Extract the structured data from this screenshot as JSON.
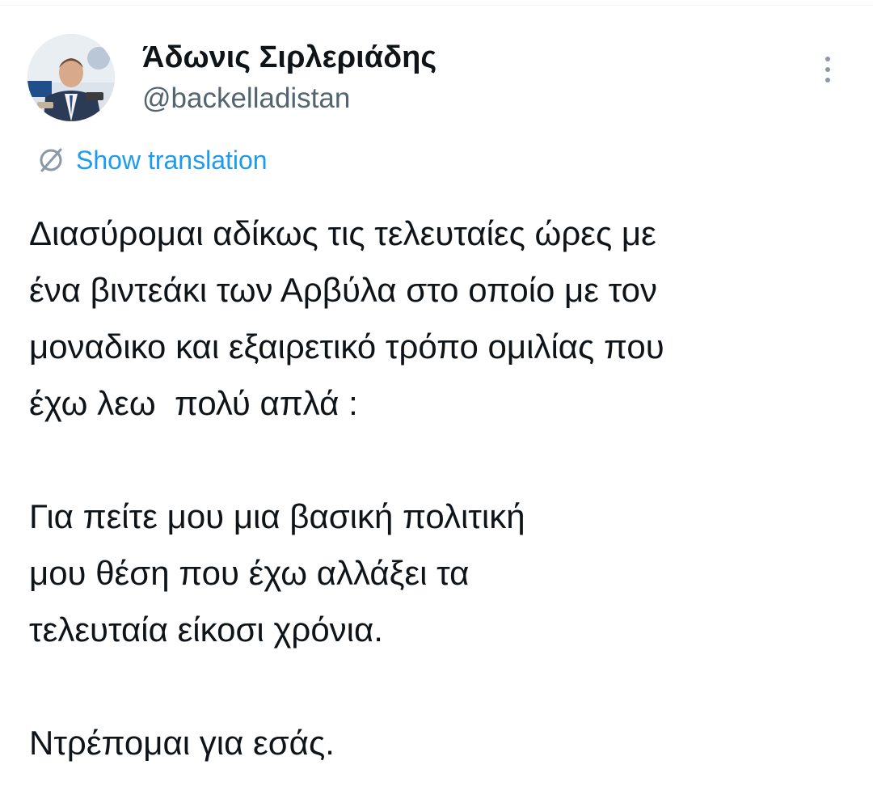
{
  "author": {
    "display_name": "Άδωνις Σιρλεριάδης",
    "handle": "@backelladistan"
  },
  "translation": {
    "label": "Show translation",
    "icon": "translate-globe-icon"
  },
  "menu": {
    "icon": "more-vertical-icon"
  },
  "tweet": {
    "paragraph_1": [
      "Διασύρομαι αδίκως τις τελευταίες ώρες με",
      "ένα βιντεάκι των Αρβύλα στο οποίο με τον",
      "μοναδικο και εξαιρετικό τρόπο ομιλίας που",
      "έχω λεω  πολύ απλά :"
    ],
    "paragraph_2": [
      "Για πείτε μου μια βασική πολιτική",
      "μου θέση που έχω αλλάξει τα",
      "τελευταία είκοσι χρόνια."
    ],
    "paragraph_3": [
      "Ντρέπομαι για εσάς."
    ]
  },
  "colors": {
    "link": "#1d9bf0",
    "secondary_text": "#536471",
    "primary_text": "#0f1419"
  }
}
